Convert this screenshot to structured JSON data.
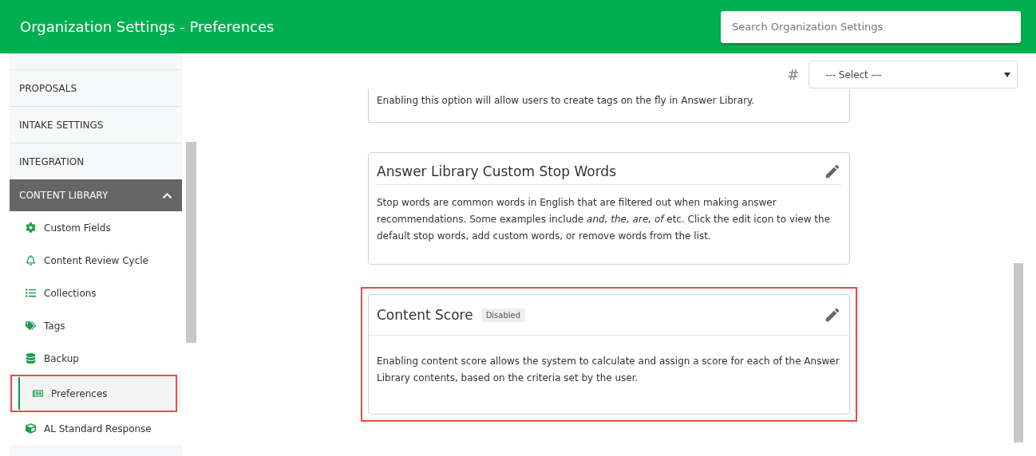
{
  "header": {
    "title": "Organization Settings - Preferences",
    "search": {
      "placeholder": "Search Organization Settings"
    }
  },
  "sidebar": {
    "sections": [
      {
        "label": "PROPOSALS"
      },
      {
        "label": "INTAKE SETTINGS"
      },
      {
        "label": "INTEGRATION"
      }
    ],
    "group": {
      "label": "CONTENT LIBRARY",
      "expanded": true,
      "items": [
        {
          "label": "Custom Fields",
          "selected": false,
          "highlighted": false
        },
        {
          "label": "Content Review Cycle",
          "selected": false,
          "highlighted": false
        },
        {
          "label": "Collections",
          "selected": false,
          "highlighted": false
        },
        {
          "label": "Tags",
          "selected": false,
          "highlighted": false
        },
        {
          "label": "Backup",
          "selected": false,
          "highlighted": false
        },
        {
          "label": "Preferences",
          "selected": true,
          "highlighted": true
        },
        {
          "label": "AL Standard Response",
          "selected": false,
          "highlighted": false
        }
      ]
    }
  },
  "filter": {
    "symbol": "#",
    "select": "--- Select ---"
  },
  "cards": [
    {
      "kind": "partial",
      "text": "Enabling this option will allow users to create tags on the fly in Answer Library.",
      "highlighted": false
    },
    {
      "kind": "inset",
      "title": "Answer Library Custom Stop Words",
      "text": "Stop words are common words in English that are filtered out when making answer recommendations. Some examples include *and, the, are, of* etc. Click the edit icon to view the default stop words, add custom words, or remove words from the list.",
      "highlighted": false
    },
    {
      "kind": "boxed",
      "title": "Content Score",
      "badge": "Disabled",
      "text": "Enabling content score allows the system to calculate and assign a score for each of the Answer Library contents, based on the criteria set by the user.",
      "highlighted": true
    }
  ]
}
